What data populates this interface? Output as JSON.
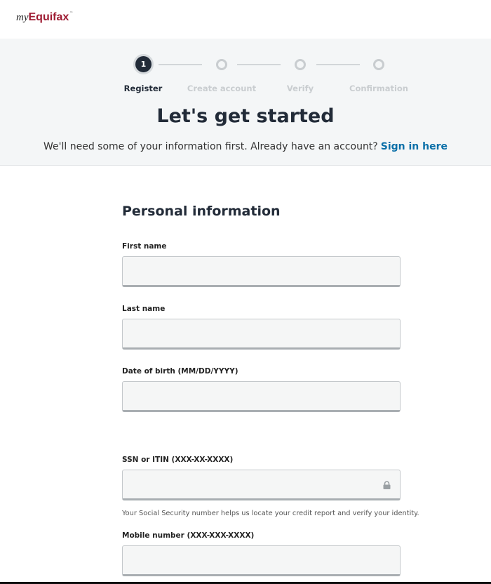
{
  "logo": {
    "my": "my",
    "brand": "Equifax",
    "tm": "™"
  },
  "stepper": {
    "steps": [
      {
        "label": "Register",
        "number": "1",
        "active": true
      },
      {
        "label": "Create account",
        "active": false
      },
      {
        "label": "Verify",
        "active": false
      },
      {
        "label": "Confirmation",
        "active": false
      }
    ]
  },
  "banner": {
    "title": "Let's get started",
    "subtitle": "We'll need some of your information first. Already have an account?",
    "sign_in_link": "Sign in here"
  },
  "form": {
    "section_title": "Personal information",
    "fields": [
      {
        "label": "First name",
        "value": ""
      },
      {
        "label": "Last name",
        "value": ""
      },
      {
        "label": "Date of birth (MM/DD/YYYY)",
        "value": ""
      },
      {
        "label": "SSN or ITIN (XXX-XX-XXXX)",
        "value": "",
        "icon": "lock-icon"
      },
      {
        "label": "Mobile number (XXX-XXX-XXXX)",
        "value": ""
      }
    ],
    "ssn_hint": "Your Social Security number helps us locate your credit report and verify your identity."
  },
  "colors": {
    "brand": "#9e1b32",
    "link": "#0a6fa8",
    "text": "#222b38"
  }
}
